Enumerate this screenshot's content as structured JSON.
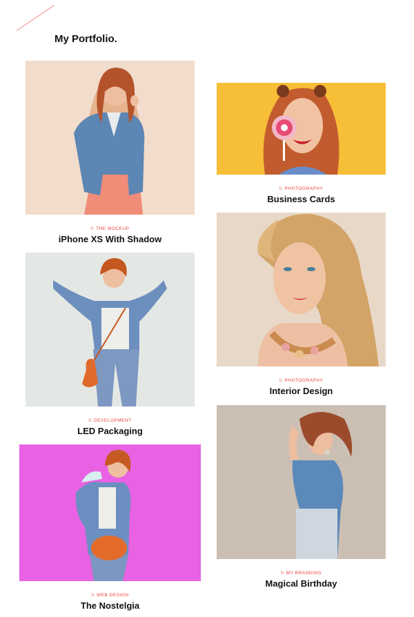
{
  "portfolio": {
    "heading": "My Portfolio."
  },
  "items": [
    {
      "category": "The Mockup",
      "slash": "\\\\",
      "title": "iPhone XS With Shadow",
      "bg": "#f2dccb"
    },
    {
      "category": "Photography",
      "slash": "\\\\",
      "title": "Business Cards",
      "bg": "#f7be37"
    },
    {
      "category": "Development",
      "slash": "\\\\",
      "title": "LED Packaging",
      "bg": "#e4e8e4"
    },
    {
      "category": "Photography",
      "slash": "\\\\",
      "title": "Interior Design",
      "bg": "#e8d8c7"
    },
    {
      "category": "Web Design",
      "slash": "\\\\",
      "title": "The Nostelgia",
      "bg": "#e862e3"
    },
    {
      "category": "My Branding",
      "slash": "\\\\",
      "title": "Magical Birthday",
      "bg": "#cbbfb3"
    }
  ],
  "colors": {
    "accent": "#e8413b",
    "text": "#111111",
    "background": "#ffffff"
  }
}
